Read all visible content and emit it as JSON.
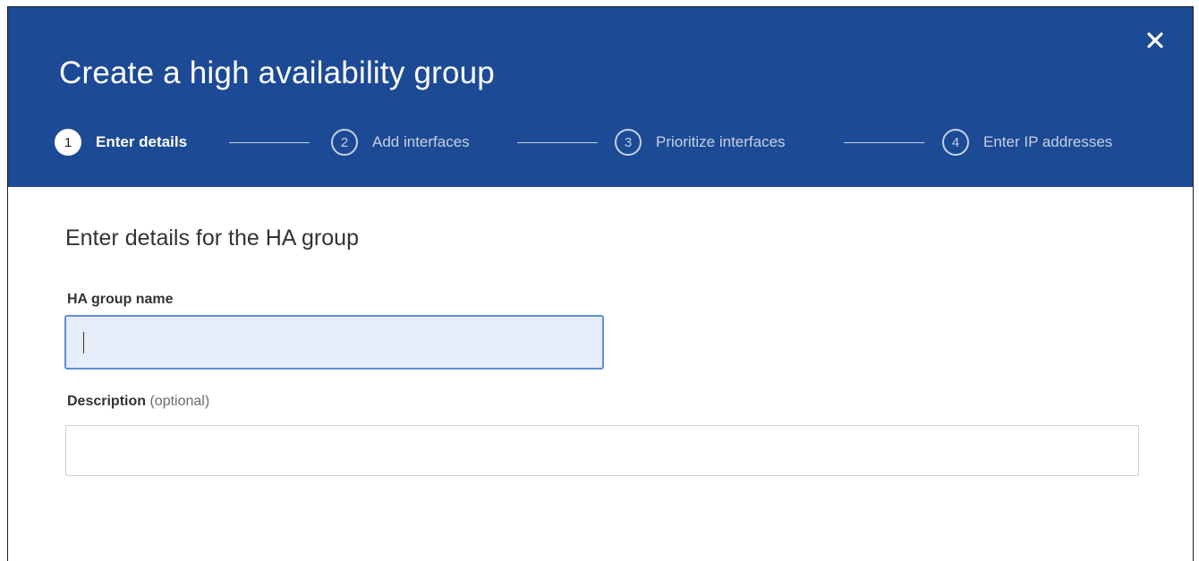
{
  "modal": {
    "title": "Create a high availability group",
    "close_icon": "close-icon"
  },
  "stepper": {
    "steps": [
      {
        "number": "1",
        "label": "Enter details",
        "state": "active"
      },
      {
        "number": "2",
        "label": "Add interfaces",
        "state": "inactive"
      },
      {
        "number": "3",
        "label": "Prioritize interfaces",
        "state": "inactive"
      },
      {
        "number": "4",
        "label": "Enter IP addresses",
        "state": "inactive"
      }
    ]
  },
  "form": {
    "section_title": "Enter details for the HA group",
    "name_field": {
      "label": "HA group name",
      "value": "",
      "placeholder": ""
    },
    "description_field": {
      "label": "Description",
      "optional_text": "(optional)",
      "value": "",
      "placeholder": ""
    }
  },
  "colors": {
    "header_bg": "#1d4a94",
    "input_focus_bg": "#e6ecf8",
    "input_focus_border": "#5d8fd6",
    "step_inactive": "#c5d0e4"
  }
}
